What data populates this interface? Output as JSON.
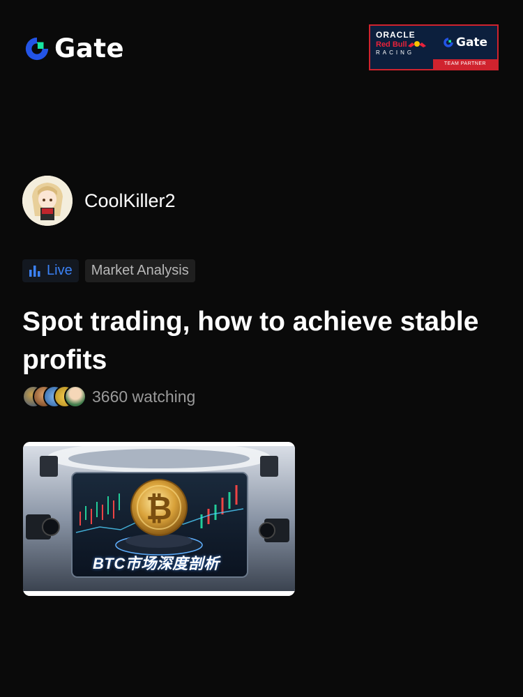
{
  "header": {
    "brand": "Gate",
    "partner_badge": {
      "oracle": "ORACLE",
      "red_bull": "Red Bull",
      "racing": "RACING",
      "gate": "Gate",
      "strip": "TEAM PARTNER"
    }
  },
  "author": {
    "name": "CoolKiller2"
  },
  "tags": {
    "live": "Live",
    "category": "Market Analysis"
  },
  "title": "Spot trading, how to achieve stable profits",
  "audience": {
    "watching": "3660 watching",
    "avatar_icons": [
      "viewer-avatar",
      "viewer-avatar",
      "viewer-avatar",
      "viewer-avatar",
      "viewer-avatar"
    ]
  },
  "thumbnail": {
    "caption": "BTC市场深度剖析",
    "coin_symbol": "₿"
  },
  "colors": {
    "accent_blue": "#3b82f6",
    "brand_blue": "#2354e6",
    "brand_green": "#17e6a1",
    "badge_red": "#d0232e",
    "badge_navy": "#0c1f3d"
  }
}
